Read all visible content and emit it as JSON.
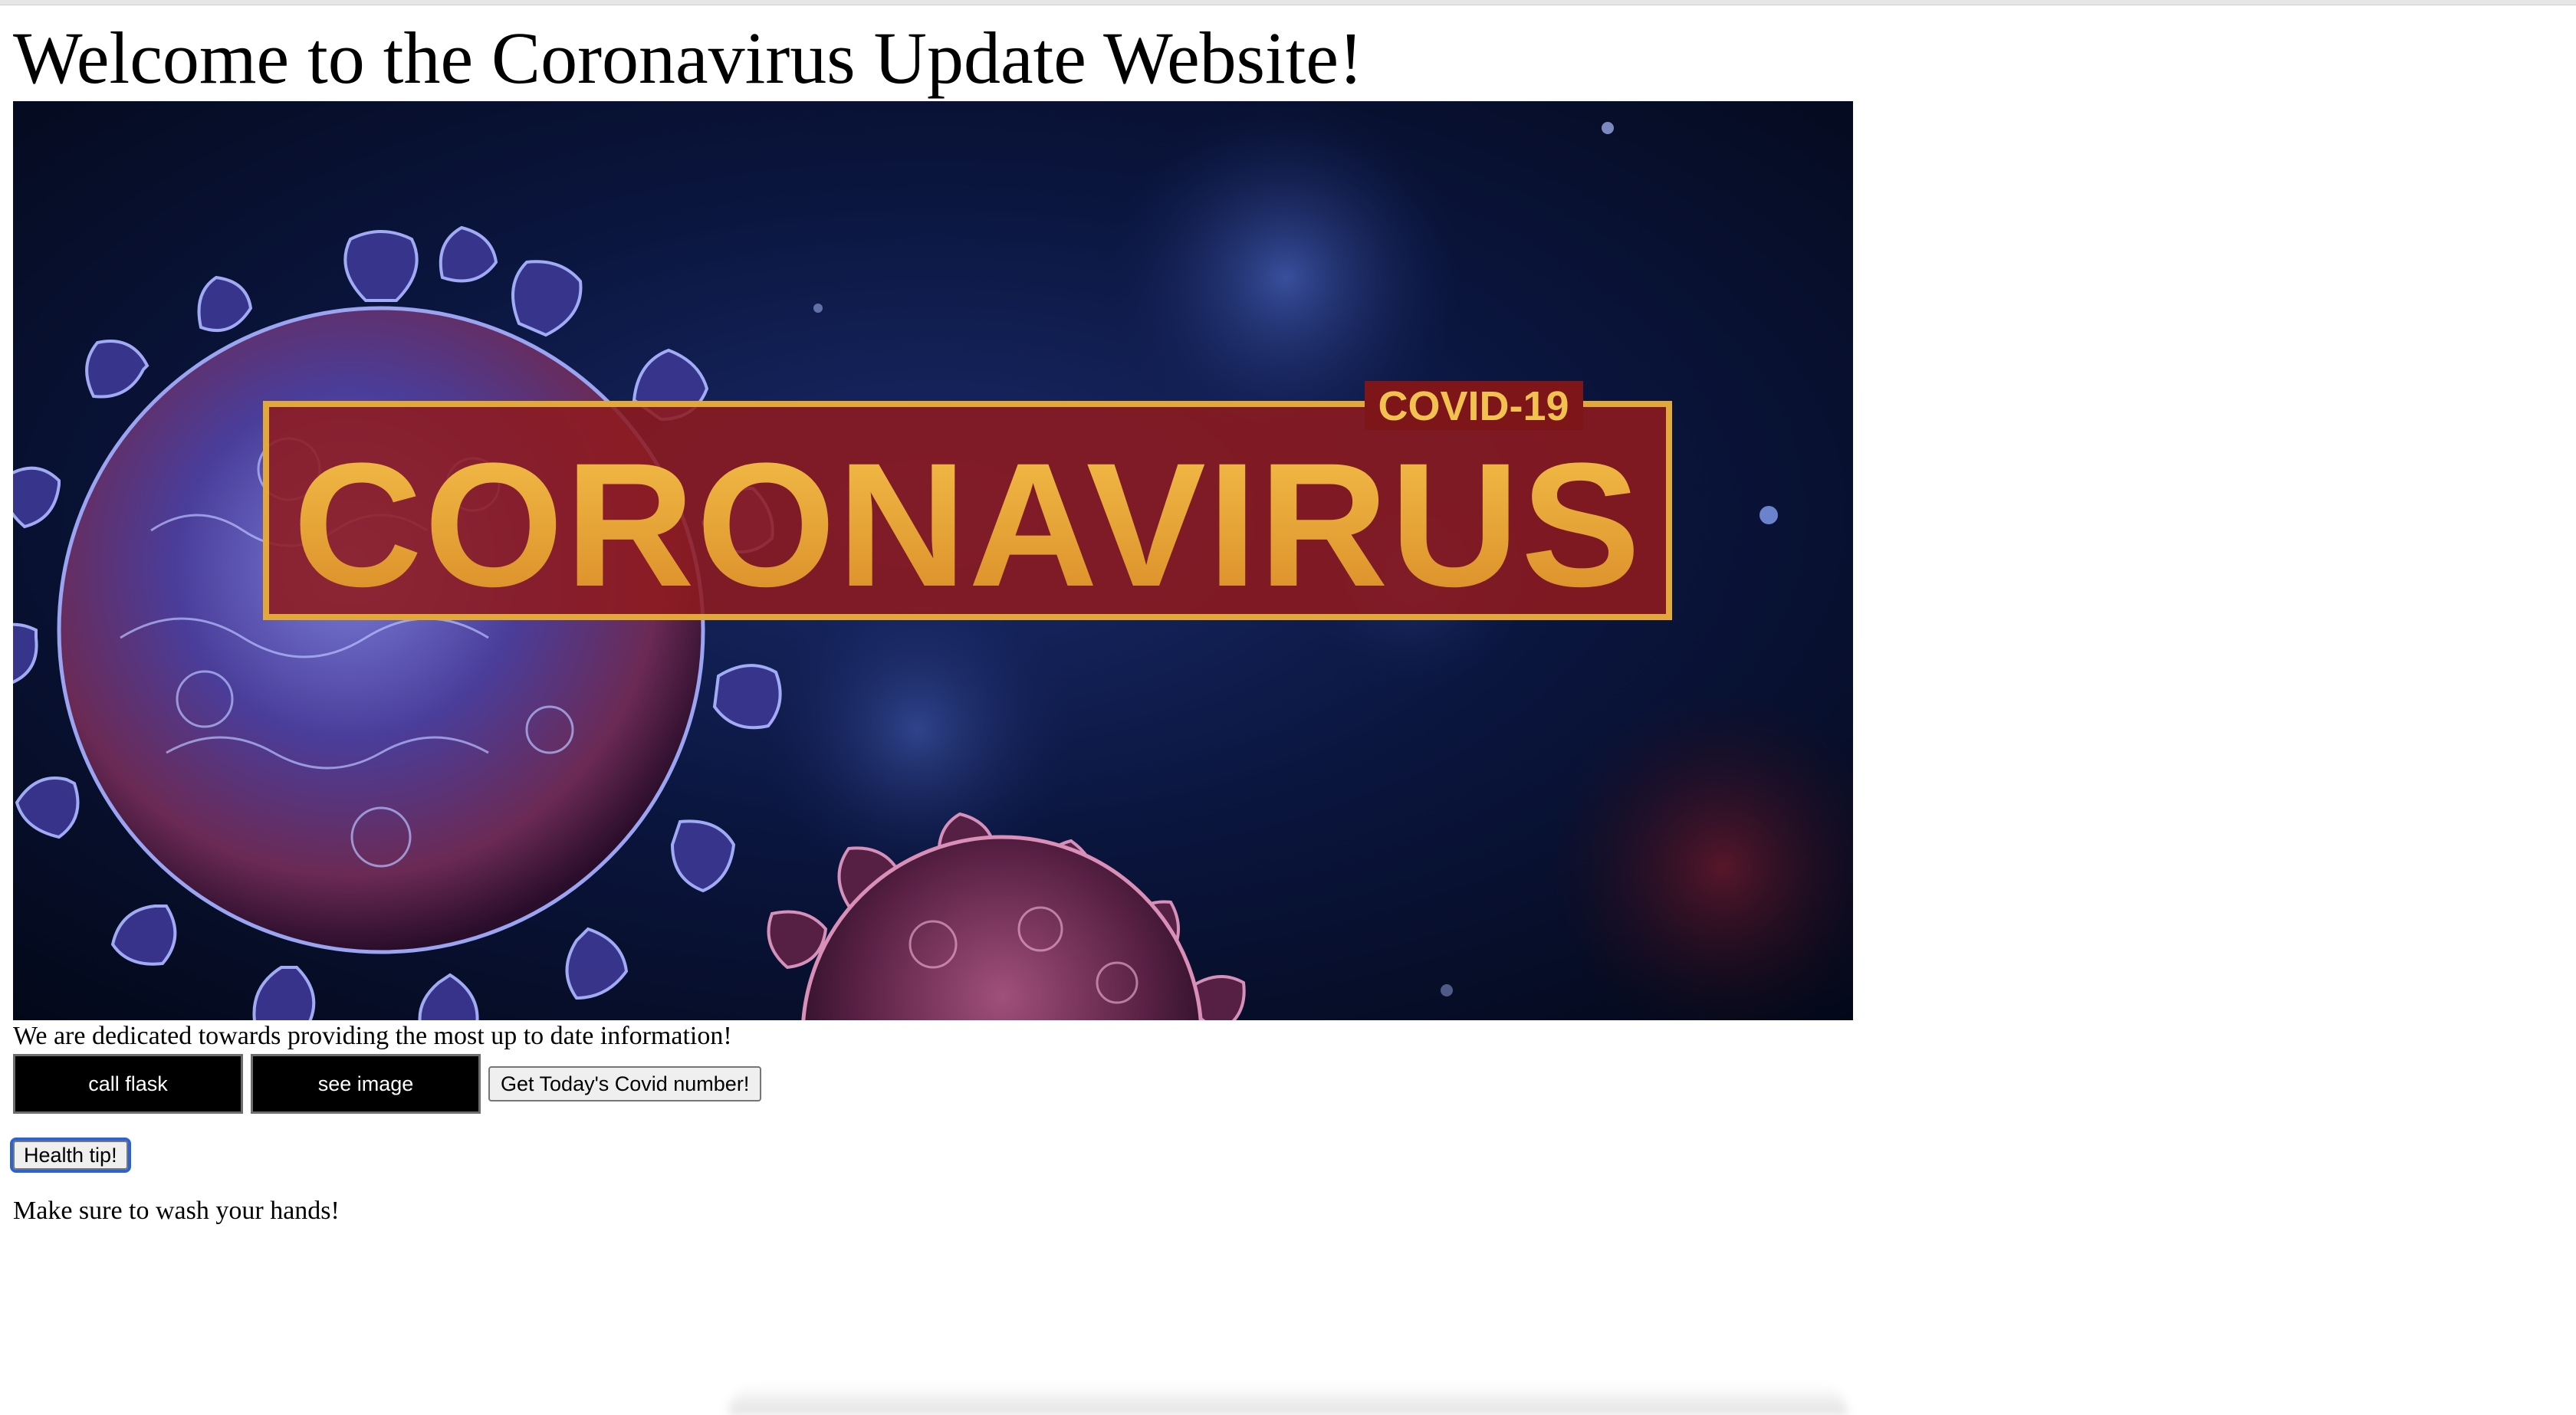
{
  "page": {
    "title": "Welcome to the Coronavirus Update Website!",
    "tagline": "We are dedicated towards providing the most up to date information!",
    "tip_text": "Make sure to wash your hands!"
  },
  "hero": {
    "banner_main": "CORONAVIRUS",
    "banner_tag": "COVID-19"
  },
  "buttons": {
    "call_flask": "call flask",
    "see_image": "see image",
    "covid_number": "Get Today's Covid number!",
    "health_tip": "Health tip!"
  },
  "colors": {
    "hero_background": "#0b1640",
    "banner_red": "#8e1a1f",
    "banner_gold": "#e2a83a",
    "focus_outline": "#2b63d4"
  }
}
